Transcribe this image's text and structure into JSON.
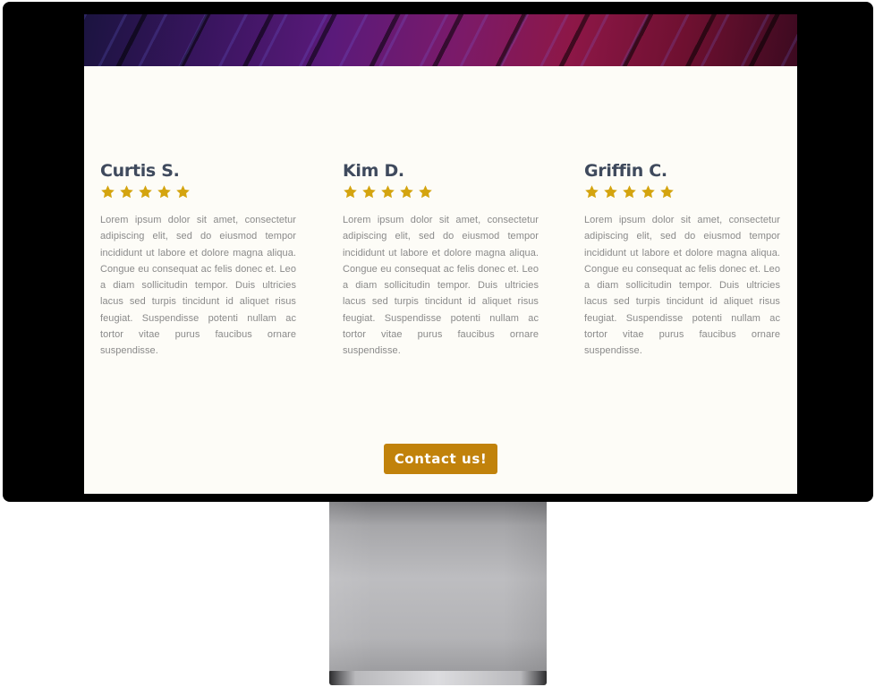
{
  "testimonials": [
    {
      "name": "Curtis S.",
      "rating": 5,
      "body": "Lorem ipsum dolor sit amet, consectetur adipiscing elit, sed do eiusmod tempor incididunt ut labore et dolore magna aliqua. Congue eu consequat ac felis donec et. Leo a diam sollicitudin tempor. Duis ultricies lacus sed turpis tincidunt id aliquet risus feugiat. Suspendisse potenti nullam ac tortor vitae purus faucibus ornare suspendisse."
    },
    {
      "name": "Kim D.",
      "rating": 5,
      "body": "Lorem ipsum dolor sit amet, consectetur adipiscing elit, sed do eiusmod tempor incididunt ut labore et dolore magna aliqua. Congue eu consequat ac felis donec et. Leo a diam sollicitudin tempor. Duis ultricies lacus sed turpis tincidunt id aliquet risus feugiat. Suspendisse potenti nullam ac tortor vitae purus faucibus ornare suspendisse."
    },
    {
      "name": "Griffin C.",
      "rating": 5,
      "body": "Lorem ipsum dolor sit amet, consectetur adipiscing elit, sed do eiusmod tempor incididunt ut labore et dolore magna aliqua. Congue eu consequat ac felis donec et. Leo a diam sollicitudin tempor. Duis ultricies lacus sed turpis tincidunt id aliquet risus feugiat. Suspendisse potenti nullam ac tortor vitae purus faucibus ornare suspendisse."
    }
  ],
  "cta": {
    "label": "Contact us!"
  },
  "icons": {
    "star": "star-icon"
  },
  "colors": {
    "star": "#d4a40f",
    "button": "#c1820b",
    "name": "#3f4a5d",
    "body_text": "#8a8a8a",
    "page_bg": "#fdfcf7"
  }
}
